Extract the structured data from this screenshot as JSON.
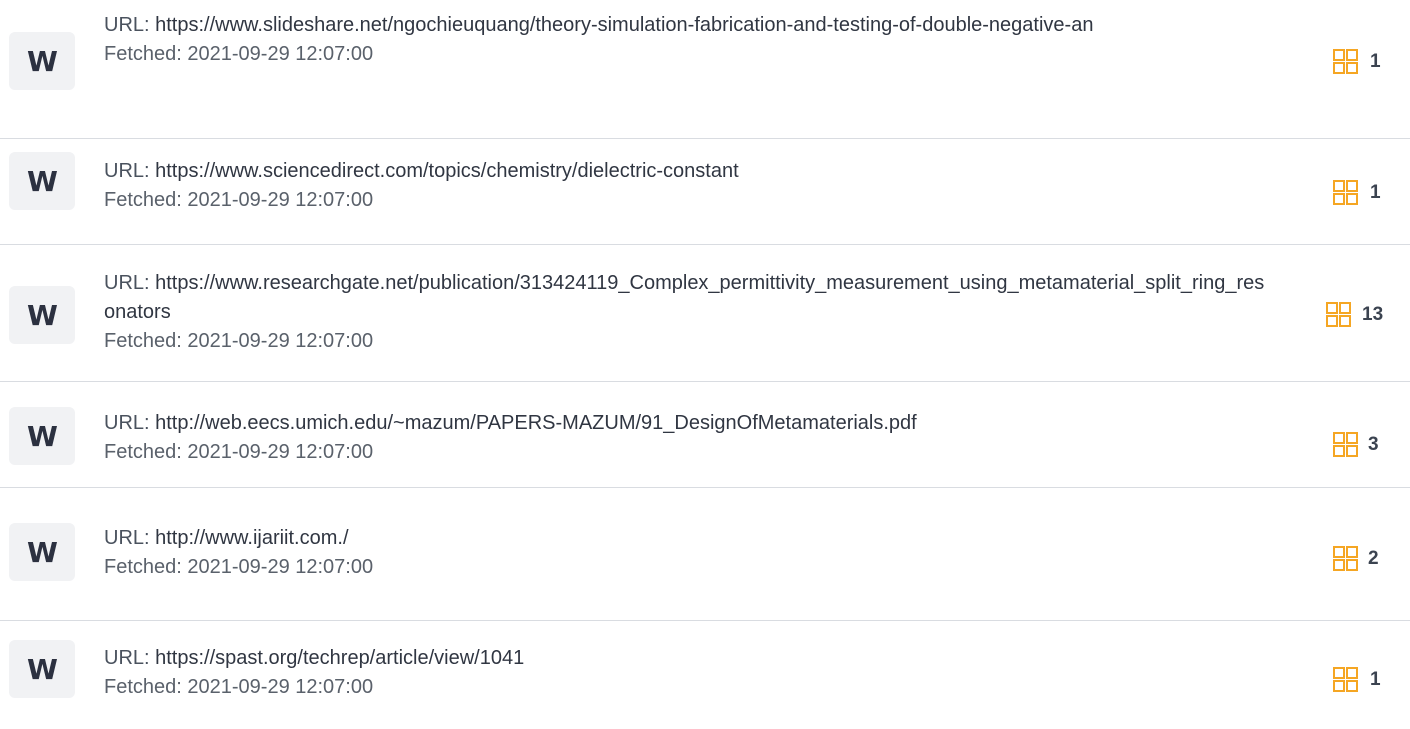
{
  "labels": {
    "url_prefix": "URL: ",
    "fetched_prefix": "Fetched: "
  },
  "colors": {
    "icon_accent": "#f5a623",
    "badge_bg": "#f1f2f4",
    "divider": "#d9dce1"
  },
  "sources": [
    {
      "badge": "W",
      "url": "https://www.slideshare.net/ngochieuquang/theory-simulation-fabrication-and-testing-of-double-negative-an",
      "fetched": "2021-09-29 12:07:00",
      "count": "1",
      "icon": "grid-icon"
    },
    {
      "badge": "W",
      "url": "https://www.sciencedirect.com/topics/chemistry/dielectric-constant",
      "fetched": "2021-09-29 12:07:00",
      "count": "1",
      "icon": "grid-icon"
    },
    {
      "badge": "W",
      "url": "https://www.researchgate.net/publication/313424119_Complex_permittivity_measurement_using_metamaterial_split_ring_resonators",
      "fetched": "2021-09-29 12:07:00",
      "count": "13",
      "icon": "grid-icon"
    },
    {
      "badge": "W",
      "url": "http://web.eecs.umich.edu/~mazum/PAPERS-MAZUM/91_DesignOfMetamaterials.pdf",
      "fetched": "2021-09-29 12:07:00",
      "count": "3",
      "icon": "grid-icon"
    },
    {
      "badge": "W",
      "url": "http://www.ijariit.com./",
      "fetched": "2021-09-29 12:07:00",
      "count": "2",
      "icon": "grid-icon"
    },
    {
      "badge": "W",
      "url": "https://spast.org/techrep/article/view/1041",
      "fetched": "2021-09-29 12:07:00",
      "count": "1",
      "icon": "grid-icon"
    }
  ]
}
